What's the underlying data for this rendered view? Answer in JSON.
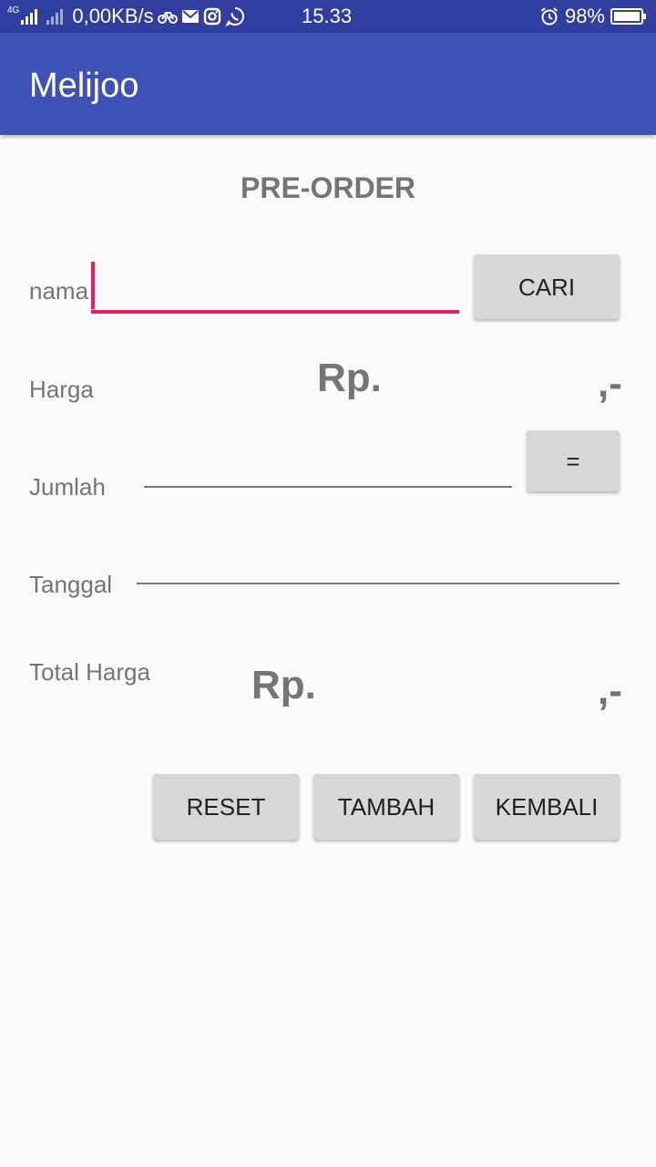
{
  "status_bar": {
    "network_type": "4G",
    "speed": "0,00KB/s",
    "time": "15.33",
    "battery": "98%",
    "icons": [
      "signal-icon",
      "signal-icon",
      "bike-icon",
      "gmail-icon",
      "instagram-icon",
      "whatsapp-icon",
      "alarm-icon",
      "battery-icon"
    ]
  },
  "app_bar": {
    "title": "Melijoo"
  },
  "form": {
    "heading": "PRE-ORDER",
    "nama": {
      "label": "nama",
      "value": "",
      "search_button": "CARI"
    },
    "harga": {
      "label": "Harga",
      "prefix": "Rp.",
      "suffix": ",-"
    },
    "jumlah": {
      "label": "Jumlah",
      "value": "",
      "calc_button": "="
    },
    "tanggal": {
      "label": "Tanggal",
      "value": ""
    },
    "total": {
      "label": "Total Harga",
      "prefix": "Rp.",
      "suffix": ",-"
    }
  },
  "actions": {
    "reset": "RESET",
    "tambah": "TAMBAH",
    "kembali": "KEMBALI"
  },
  "colors": {
    "status_bar": "#303f9f",
    "app_bar": "#3f51b5",
    "accent": "#e91e63",
    "button": "#d6d7d7"
  }
}
